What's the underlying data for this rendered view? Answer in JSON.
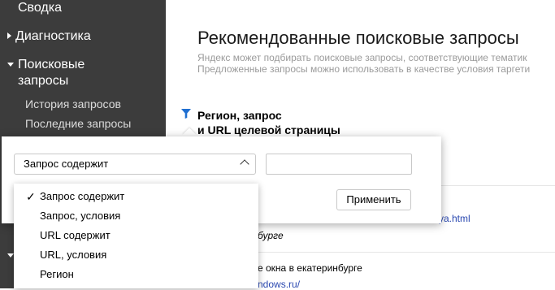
{
  "sidebar": {
    "summary": "Сводка",
    "diagnostics": "Диагностика",
    "search_queries_line1": "Поисковые",
    "search_queries_line2": "запросы",
    "sub_history": "История запросов",
    "sub_recent": "Последние запросы"
  },
  "page": {
    "title": "Рекомендованные поисковые запросы",
    "subtitle_line1": "Яндекс может подбирать поисковые запросы, соответствующие тематик",
    "subtitle_line2": "Предложенные запросы можно использовать в качестве условия таргети"
  },
  "column": {
    "header_line1": "Регион, запрос",
    "header_line2": "и URL целевой страницы"
  },
  "background_rows": {
    "row1_link": "ya.html",
    "row1_italic": "бурге",
    "row2_text": "е окна в екатеринбурге",
    "row2_link": "ndows.ru/"
  },
  "filter_popup": {
    "select_value": "Запрос содержит",
    "input_value": "",
    "apply_label": "Применить"
  },
  "dropdown": {
    "selected_mark": "✓",
    "options": [
      "Запрос содержит",
      "Запрос, условия",
      "URL содержит",
      "URL, условия",
      "Регион"
    ]
  },
  "colors": {
    "sidebar_bg": "#3c3c3c",
    "link": "#2a48b0",
    "filter_icon": "#1f6fd1"
  }
}
